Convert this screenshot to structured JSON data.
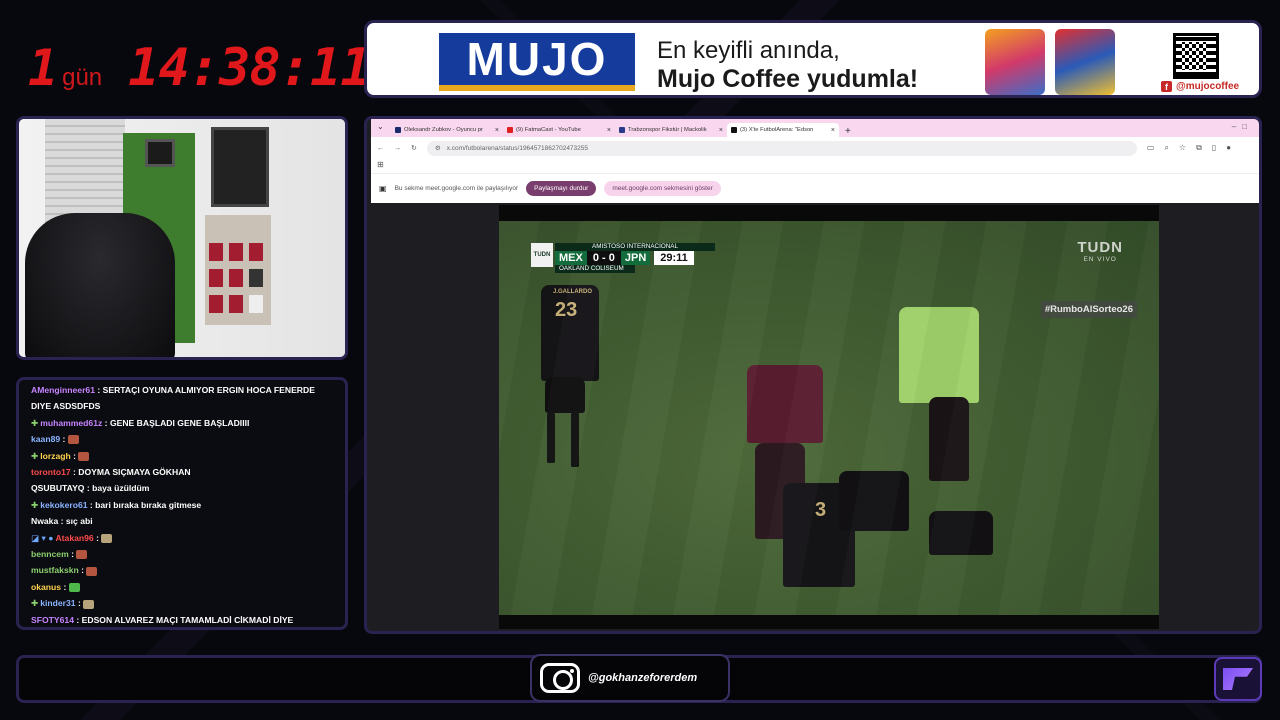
{
  "countdown": {
    "days": "1",
    "unit": "gün",
    "time": "14:38:11"
  },
  "ad": {
    "logo_text": "MUJO",
    "line1": "En keyifli anında,",
    "line2": "Mujo Coffee yudumla!",
    "social_handle": "@mujocoffee"
  },
  "chat": {
    "messages": [
      {
        "user": "AMenginneer61",
        "user_color": "#c785ff",
        "text": "SERTAÇI OYUNA ALMIYOR ERGIN HOCA FENERDE DIYE ASDSDFDS",
        "badge": "",
        "emote": ""
      },
      {
        "user": "muhammed61z",
        "user_color": "#c785ff",
        "text": "GENE BAŞLADI GENE BAŞLADIIII",
        "badge": "diamond",
        "emote": ""
      },
      {
        "user": "kaan89",
        "user_color": "#8ab4ff",
        "text": "",
        "badge": "",
        "emote": "#b3553f"
      },
      {
        "user": "lorzagh",
        "user_color": "#ffd34a",
        "text": "",
        "badge": "diamond",
        "emote": "#b3553f"
      },
      {
        "user": "toronto17",
        "user_color": "#ff4b4b",
        "text": "DOYMA SIÇMAYA GÖKHAN",
        "badge": "",
        "emote": ""
      },
      {
        "user": "QSUBUTAYQ",
        "user_color": "#ffffff",
        "text": "baya üzüldüm",
        "badge": "",
        "emote": ""
      },
      {
        "user": "kekokero61",
        "user_color": "#8ab4ff",
        "text": "bari bıraka bıraka gitmese",
        "badge": "diamond",
        "emote": ""
      },
      {
        "user": "Nwaka",
        "user_color": "#ffffff",
        "text": "sıç abi",
        "badge": "",
        "emote": ""
      },
      {
        "user": "Atakan96",
        "user_color": "#ff4b4b",
        "text": "",
        "badge": "multi",
        "emote": "#b8a47a"
      },
      {
        "user": "benncem",
        "user_color": "#8bd16d",
        "text": "",
        "badge": "",
        "emote": "#b3553f"
      },
      {
        "user": "mustfakskn",
        "user_color": "#8bd16d",
        "text": "",
        "badge": "",
        "emote": "#b3553f"
      },
      {
        "user": "okanus",
        "user_color": "#ffd34a",
        "text": "",
        "badge": "",
        "emote": "#4fb84a"
      },
      {
        "user": "kinder31",
        "user_color": "#8ab4ff",
        "text": "",
        "badge": "diamond",
        "emote": "#b8a47a"
      },
      {
        "user": "SFOTY614",
        "user_color": "#c785ff",
        "text": "EDSON ALVAREZ MAÇI TAMAMLADİ CİKMADİ DİYE GORDUM BİRYERDE",
        "badge": "",
        "emote": ""
      }
    ]
  },
  "browser": {
    "tabs": [
      {
        "label": "Oleksandr Zubkov - Oyuncu pr",
        "icon_color": "#1a2a6e",
        "active": false
      },
      {
        "label": "(9) FatmaCast - YouTube",
        "icon_color": "#e02020",
        "active": false
      },
      {
        "label": "Trabzonspor Fikstür | Mackolik",
        "icon_color": "#2a3a8a",
        "active": false
      },
      {
        "label": "(3) X'te FutbolArena: \"Edson",
        "icon_color": "#111111",
        "active": true
      }
    ],
    "url": "x.com/futbolarena/status/1964571862702473255",
    "share_text": "Bu sekme meet.google.com ile paylaşılıyor",
    "stop_button": "Paylaşmayı durdur",
    "show_button": "meet.google.com sekmesini göster"
  },
  "video": {
    "competition": "AMISTOSO INTERNACIONAL",
    "home": "MEX",
    "away": "JPN",
    "score": "0 - 0",
    "clock": "29:11",
    "venue": "OAKLAND COLISEUM",
    "broadcaster": "TUDN",
    "broadcaster_sub": "EN VIVO",
    "broadcaster_badge": "TUDN",
    "hashtag": "#RumboAlSorteo26",
    "player_name": "J.GALLARDO",
    "player_number": "23",
    "player2_number": "3"
  },
  "footer": {
    "instagram_handle": "@gokhanzeforerdem"
  }
}
